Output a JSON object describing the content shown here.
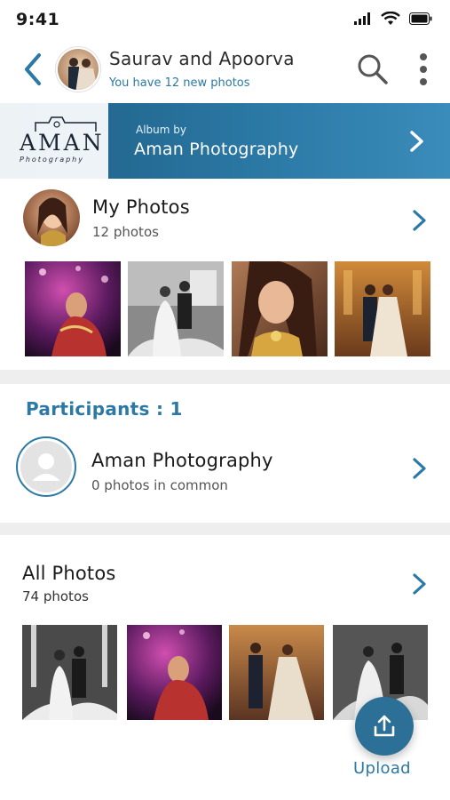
{
  "status_bar": {
    "time": "9:41"
  },
  "header": {
    "title": "Saurav and Apoorva",
    "subtitle": "You have 12 new photos"
  },
  "banner": {
    "brand_logo_text": "AMAN",
    "brand_logo_subtext": "Photography",
    "album_by_label": "Album by",
    "album_name": "Aman Photography"
  },
  "my_photos": {
    "title": "My Photos",
    "count_label": "12 photos",
    "thumbnails": [
      "purple-lit-bride-photo",
      "bw-couple-photo",
      "bride-portrait-photo",
      "couple-hall-photo"
    ]
  },
  "participants": {
    "title": "Participants : 1",
    "items": [
      {
        "name": "Aman Photography",
        "detail": "0 photos in common"
      }
    ]
  },
  "all_photos": {
    "title": "All Photos",
    "count_label": "74 photos",
    "thumbnails": [
      "bw-couple-sparklers-photo",
      "purple-lit-bride-photo",
      "couple-dancing-photo",
      "bw-couple-dance-photo"
    ]
  },
  "upload": {
    "label": "Upload"
  },
  "colors": {
    "accent": "#2b79a4",
    "banner_start": "#1e5e84",
    "banner_end": "#3a8cba",
    "divider": "#eeeeee"
  }
}
